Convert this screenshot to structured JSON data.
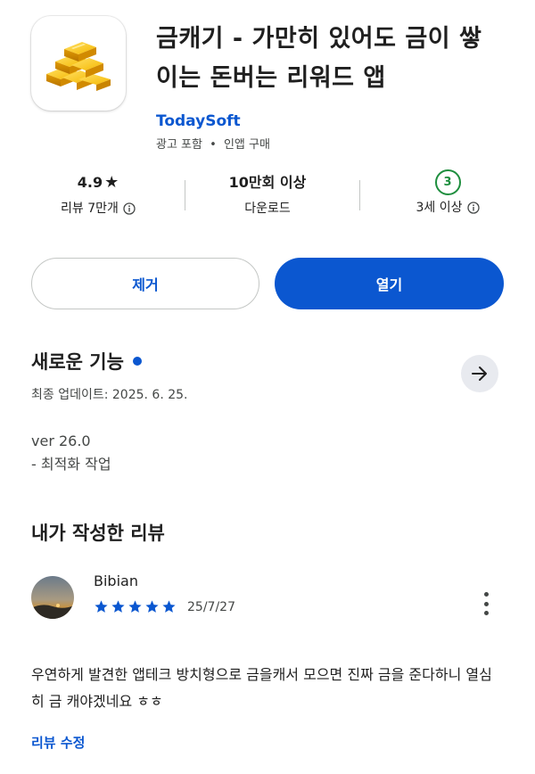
{
  "app": {
    "title": "금캐기 - 가만히 있어도 금이 쌓이는 돈버는 리워드 앱",
    "developer": "TodaySoft",
    "meta_ads": "광고 포함",
    "meta_separator": "•",
    "meta_iap": "인앱 구매",
    "icon": "gold-bars-icon"
  },
  "stats": {
    "rating_value": "4.9",
    "rating_star": "★",
    "reviews_label": "리뷰 7만개",
    "downloads_value": "10만회 이상",
    "downloads_label": "다운로드",
    "age_value": "3",
    "age_label": "3세 이상"
  },
  "actions": {
    "remove_label": "제거",
    "open_label": "열기"
  },
  "whats_new": {
    "title": "새로운 기능",
    "updated": "최종 업데이트: 2025. 6. 25.",
    "version": "ver 26.0",
    "note": "- 최적화 작업"
  },
  "my_review": {
    "section_title": "내가 작성한 리뷰",
    "reviewer": "Bibian",
    "stars": 5,
    "date": "25/7/27",
    "text": "우연하게 발견한 앱테크 방치형으로 금을캐서 모으면 진짜 금을 준다하니 열심히 금 캐야겠네요 ㅎㅎ",
    "edit_label": "리뷰 수정"
  },
  "colors": {
    "accent": "#0b57d0",
    "text": "#1f1f1f",
    "secondary": "#444746",
    "age_green": "#1e8e3e",
    "arrow_bg": "#e8eaef",
    "gold": "#f0b400"
  }
}
